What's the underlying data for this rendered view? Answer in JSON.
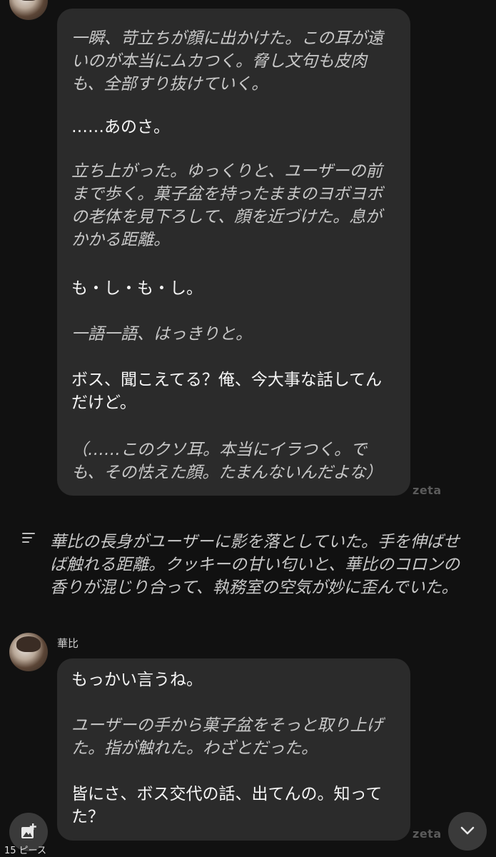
{
  "message1": {
    "lines": [
      {
        "text": "一瞬、苛立ちが顔に出かけた。この耳が遠",
        "style": "narr"
      },
      {
        "text": "いのが本当にムカつく。脅し文句も皮肉",
        "style": "narr"
      },
      {
        "text": "も、全部すり抜けていく。",
        "style": "narr"
      },
      {
        "text": "……あのさ。",
        "style": "dlg"
      },
      {
        "text": "立ち上がった。ゆっくりと、ユーザーの前",
        "style": "narr"
      },
      {
        "text": "まで歩く。菓子盆を持ったままのヨボヨボ",
        "style": "narr"
      },
      {
        "text": "の老体を見下ろして、顔を近づけた。息が",
        "style": "narr"
      },
      {
        "text": "かかる距離。",
        "style": "narr"
      },
      {
        "text": "も・し・も・し。",
        "style": "dlg"
      },
      {
        "text": "一語一語、はっきりと。",
        "style": "narr"
      },
      {
        "text": "ボス、聞こえてる？俺、今大事な話してん",
        "style": "dlg"
      },
      {
        "text": "だけど。",
        "style": "dlg"
      },
      {
        "text": "（……このクソ耳。本当にイラつく。で",
        "style": "narr"
      },
      {
        "text": "も、その怯えた顔。たまんないんだよな）",
        "style": "narr"
      }
    ],
    "watermark": "zeta"
  },
  "system_narration": {
    "icon": "text-lines-icon",
    "lines": [
      "華比の長身がユーザーに影を落としていた。手を伸ばせ",
      "ば触れる距離。クッキーの甘い匂いと、華比のコロンの",
      "香りが混じり合って、執務室の空気が妙に歪んでいた。"
    ]
  },
  "message2": {
    "sender": "華比",
    "lines": [
      {
        "text": "もっかい言うね。",
        "style": "dlg"
      },
      {
        "text": "ユーザーの手から菓子盆をそっと取り上げ",
        "style": "narr"
      },
      {
        "text": "た。指が触れた。わざとだった。",
        "style": "narr"
      },
      {
        "text": "皆にさ、ボス交代の話、出てんの。知って",
        "style": "dlg"
      },
      {
        "text": "た？",
        "style": "dlg"
      }
    ],
    "watermark": "zeta"
  },
  "footer": {
    "image_button_icon": "add-image-icon",
    "pieces_label": "15 ピース",
    "scroll_button_icon": "chevron-down-icon"
  },
  "colors": {
    "background": "#111111",
    "bubble": "#2b2b2b",
    "narration_text": "#c8c8c8",
    "dialogue_text": "#f5f5f5"
  }
}
